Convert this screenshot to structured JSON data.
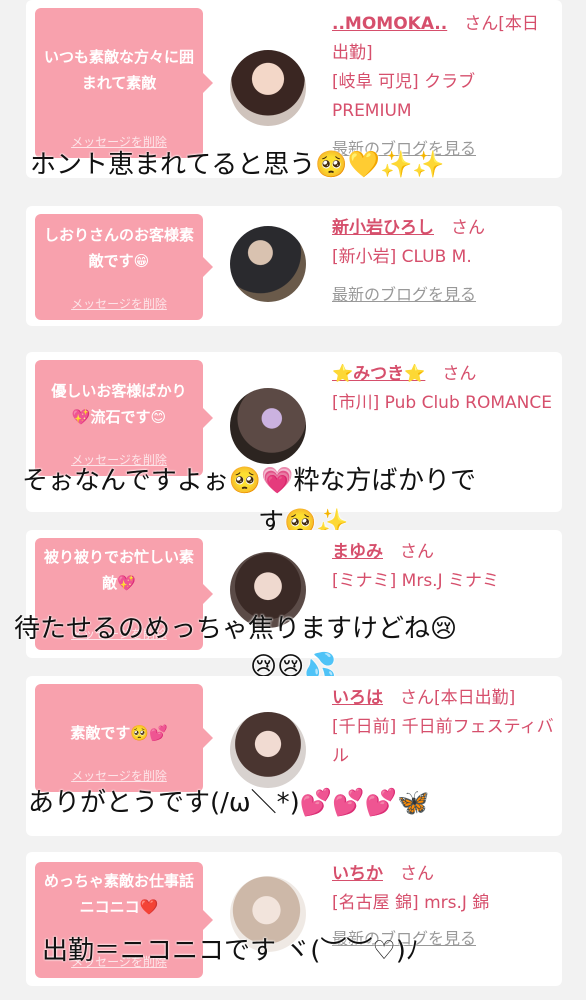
{
  "delete_label": "メッセージを削除",
  "blog_label": "最新のブログを見る",
  "accent_color": "#f8a1ad",
  "name_color": "#d64f6c",
  "cards": [
    {
      "message": "いつも素敵な方々に囲まれて素敵",
      "name": "..MOMOKA..",
      "suffix": "さん[本日出勤]",
      "shop": "[岐阜 可児] クラブ PREMIUM",
      "caption": "ホント恵まれてると思う🥺💛✨✨"
    },
    {
      "message": "しおりさんのお客様素敵です😁",
      "name": "新小岩ひろし",
      "suffix": "さん",
      "shop": "[新小岩] CLUB M.",
      "caption": ""
    },
    {
      "message": "優しいお客様ばかり💖流石です😊",
      "name": "⭐みつき⭐",
      "suffix": "さん",
      "shop": "[市川] Pub Club ROMANCE",
      "caption": "そぉなんですよぉ🥺💗粋な方ばかりで",
      "caption2": "す🥺✨"
    },
    {
      "message": "被り被りでお忙しい素敵💖",
      "name": "まゆみ",
      "suffix": "さん",
      "shop": "[ミナミ] Mrs.J ミナミ",
      "caption": "待たせるのめっちゃ焦りますけどね😢",
      "caption2": "😢😢💦"
    },
    {
      "message": "素敵です🥺💕",
      "name": "いろは",
      "suffix": "さん[本日出勤]",
      "shop": "[千日前] 千日前フェスティバル",
      "caption": "ありがとうです(/ω＼*)💕💕💕🦋"
    },
    {
      "message": "めっちゃ素敵お仕事話ニコニコ❤️",
      "name": "いちか",
      "suffix": "さん",
      "shop": "[名古屋 錦] mrs.J 錦",
      "caption": "出勤＝ニコニコです ヾ(︶︶♡)ﾉ"
    }
  ]
}
